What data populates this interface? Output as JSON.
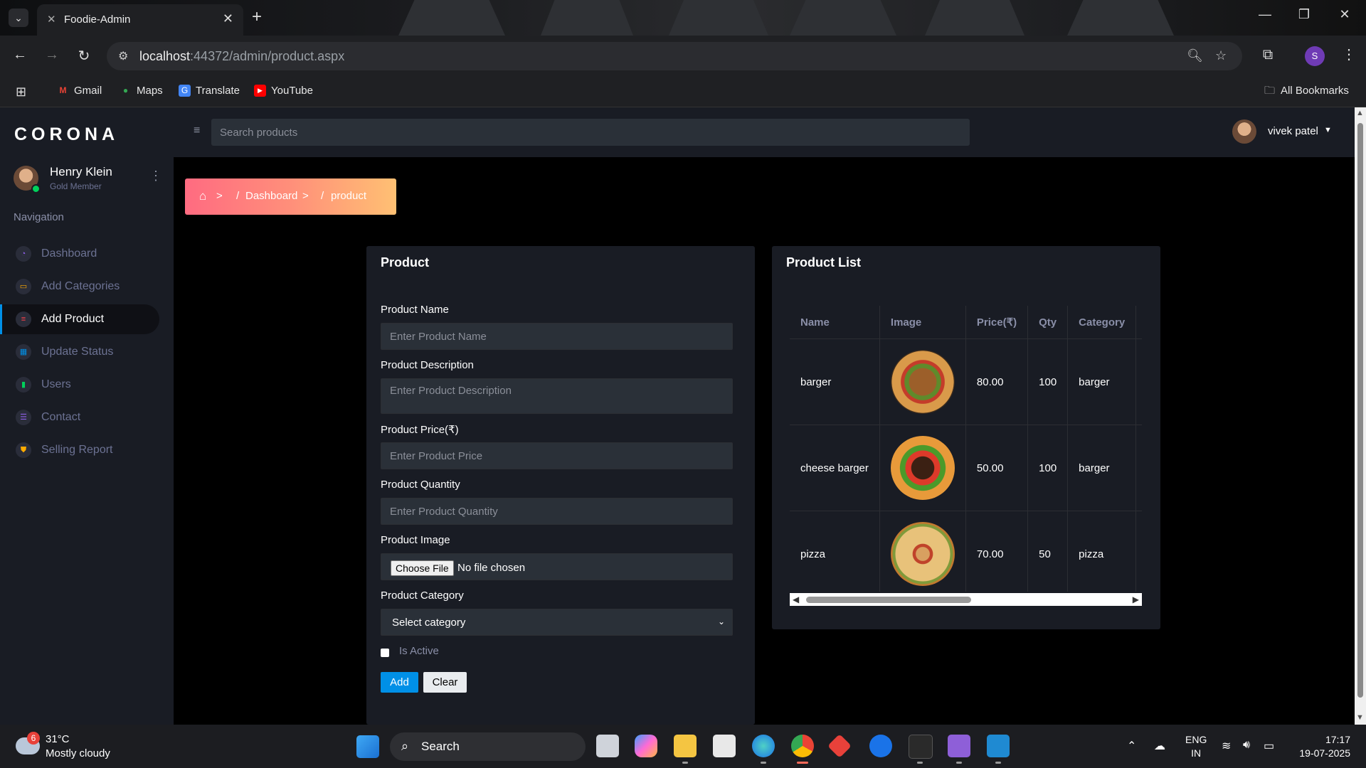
{
  "browser": {
    "tab_title": "Foodie-Admin",
    "url_host": "localhost",
    "url_rest": ":44372/admin/product.aspx",
    "profile_initial": "S",
    "bookmarks": [
      "Gmail",
      "Maps",
      "Translate",
      "YouTube"
    ],
    "all_bookmarks": "All Bookmarks"
  },
  "sidebar": {
    "brand": "CORONA",
    "profile_name": "Henry Klein",
    "profile_role": "Gold Member",
    "nav_heading": "Navigation",
    "items": [
      {
        "label": "Dashboard",
        "icon": "speedometer-icon",
        "color": "#8f5fe8"
      },
      {
        "label": "Add Categories",
        "icon": "laptop-icon",
        "color": "#ffab00"
      },
      {
        "label": "Add Product",
        "icon": "playlist-icon",
        "color": "#fc424a"
      },
      {
        "label": "Update Status",
        "icon": "table-icon",
        "color": "#0090e7"
      },
      {
        "label": "Users",
        "icon": "chart-icon",
        "color": "#00d25b"
      },
      {
        "label": "Contact",
        "icon": "contacts-icon",
        "color": "#8f5fe8"
      },
      {
        "label": "Selling Report",
        "icon": "shield-icon",
        "color": "#ffab00"
      }
    ],
    "active_item": "Add Product"
  },
  "topbar": {
    "search_placeholder": "Search products",
    "user_name": "vivek patel"
  },
  "breadcrumb": {
    "items": [
      "Dashboard",
      "product"
    ]
  },
  "product_form": {
    "title": "Product",
    "name_label": "Product Name",
    "name_placeholder": "Enter Product Name",
    "desc_label": "Product Description",
    "desc_placeholder": "Enter Product Description",
    "price_label": "Product Price(₹)",
    "price_placeholder": "Enter Product Price",
    "qty_label": "Product Quantity",
    "qty_placeholder": "Enter Product Quantity",
    "image_label": "Product Image",
    "choose_file": "Choose File",
    "no_file": "No file chosen",
    "category_label": "Product Category",
    "category_selected": "Select category",
    "is_active_label": "Is Active",
    "add_button": "Add",
    "clear_button": "Clear"
  },
  "product_list": {
    "title": "Product List",
    "columns": [
      "Name",
      "Image",
      "Price(₹)",
      "Qty",
      "Category"
    ],
    "rows": [
      {
        "name": "barger",
        "image": "burger-image",
        "price": "80.00",
        "qty": "100",
        "category": "barger"
      },
      {
        "name": "cheese barger",
        "image": "cheese-burger-image",
        "price": "50.00",
        "qty": "100",
        "category": "barger"
      },
      {
        "name": "pizza",
        "image": "pizza-image",
        "price": "70.00",
        "qty": "50",
        "category": "pizza"
      }
    ]
  },
  "taskbar": {
    "weather_badge": "6",
    "temperature": "31°C",
    "condition": "Mostly cloudy",
    "search_label": "Search",
    "lang_top": "ENG",
    "lang_bottom": "IN",
    "time": "17:17",
    "date": "19-07-2025"
  }
}
